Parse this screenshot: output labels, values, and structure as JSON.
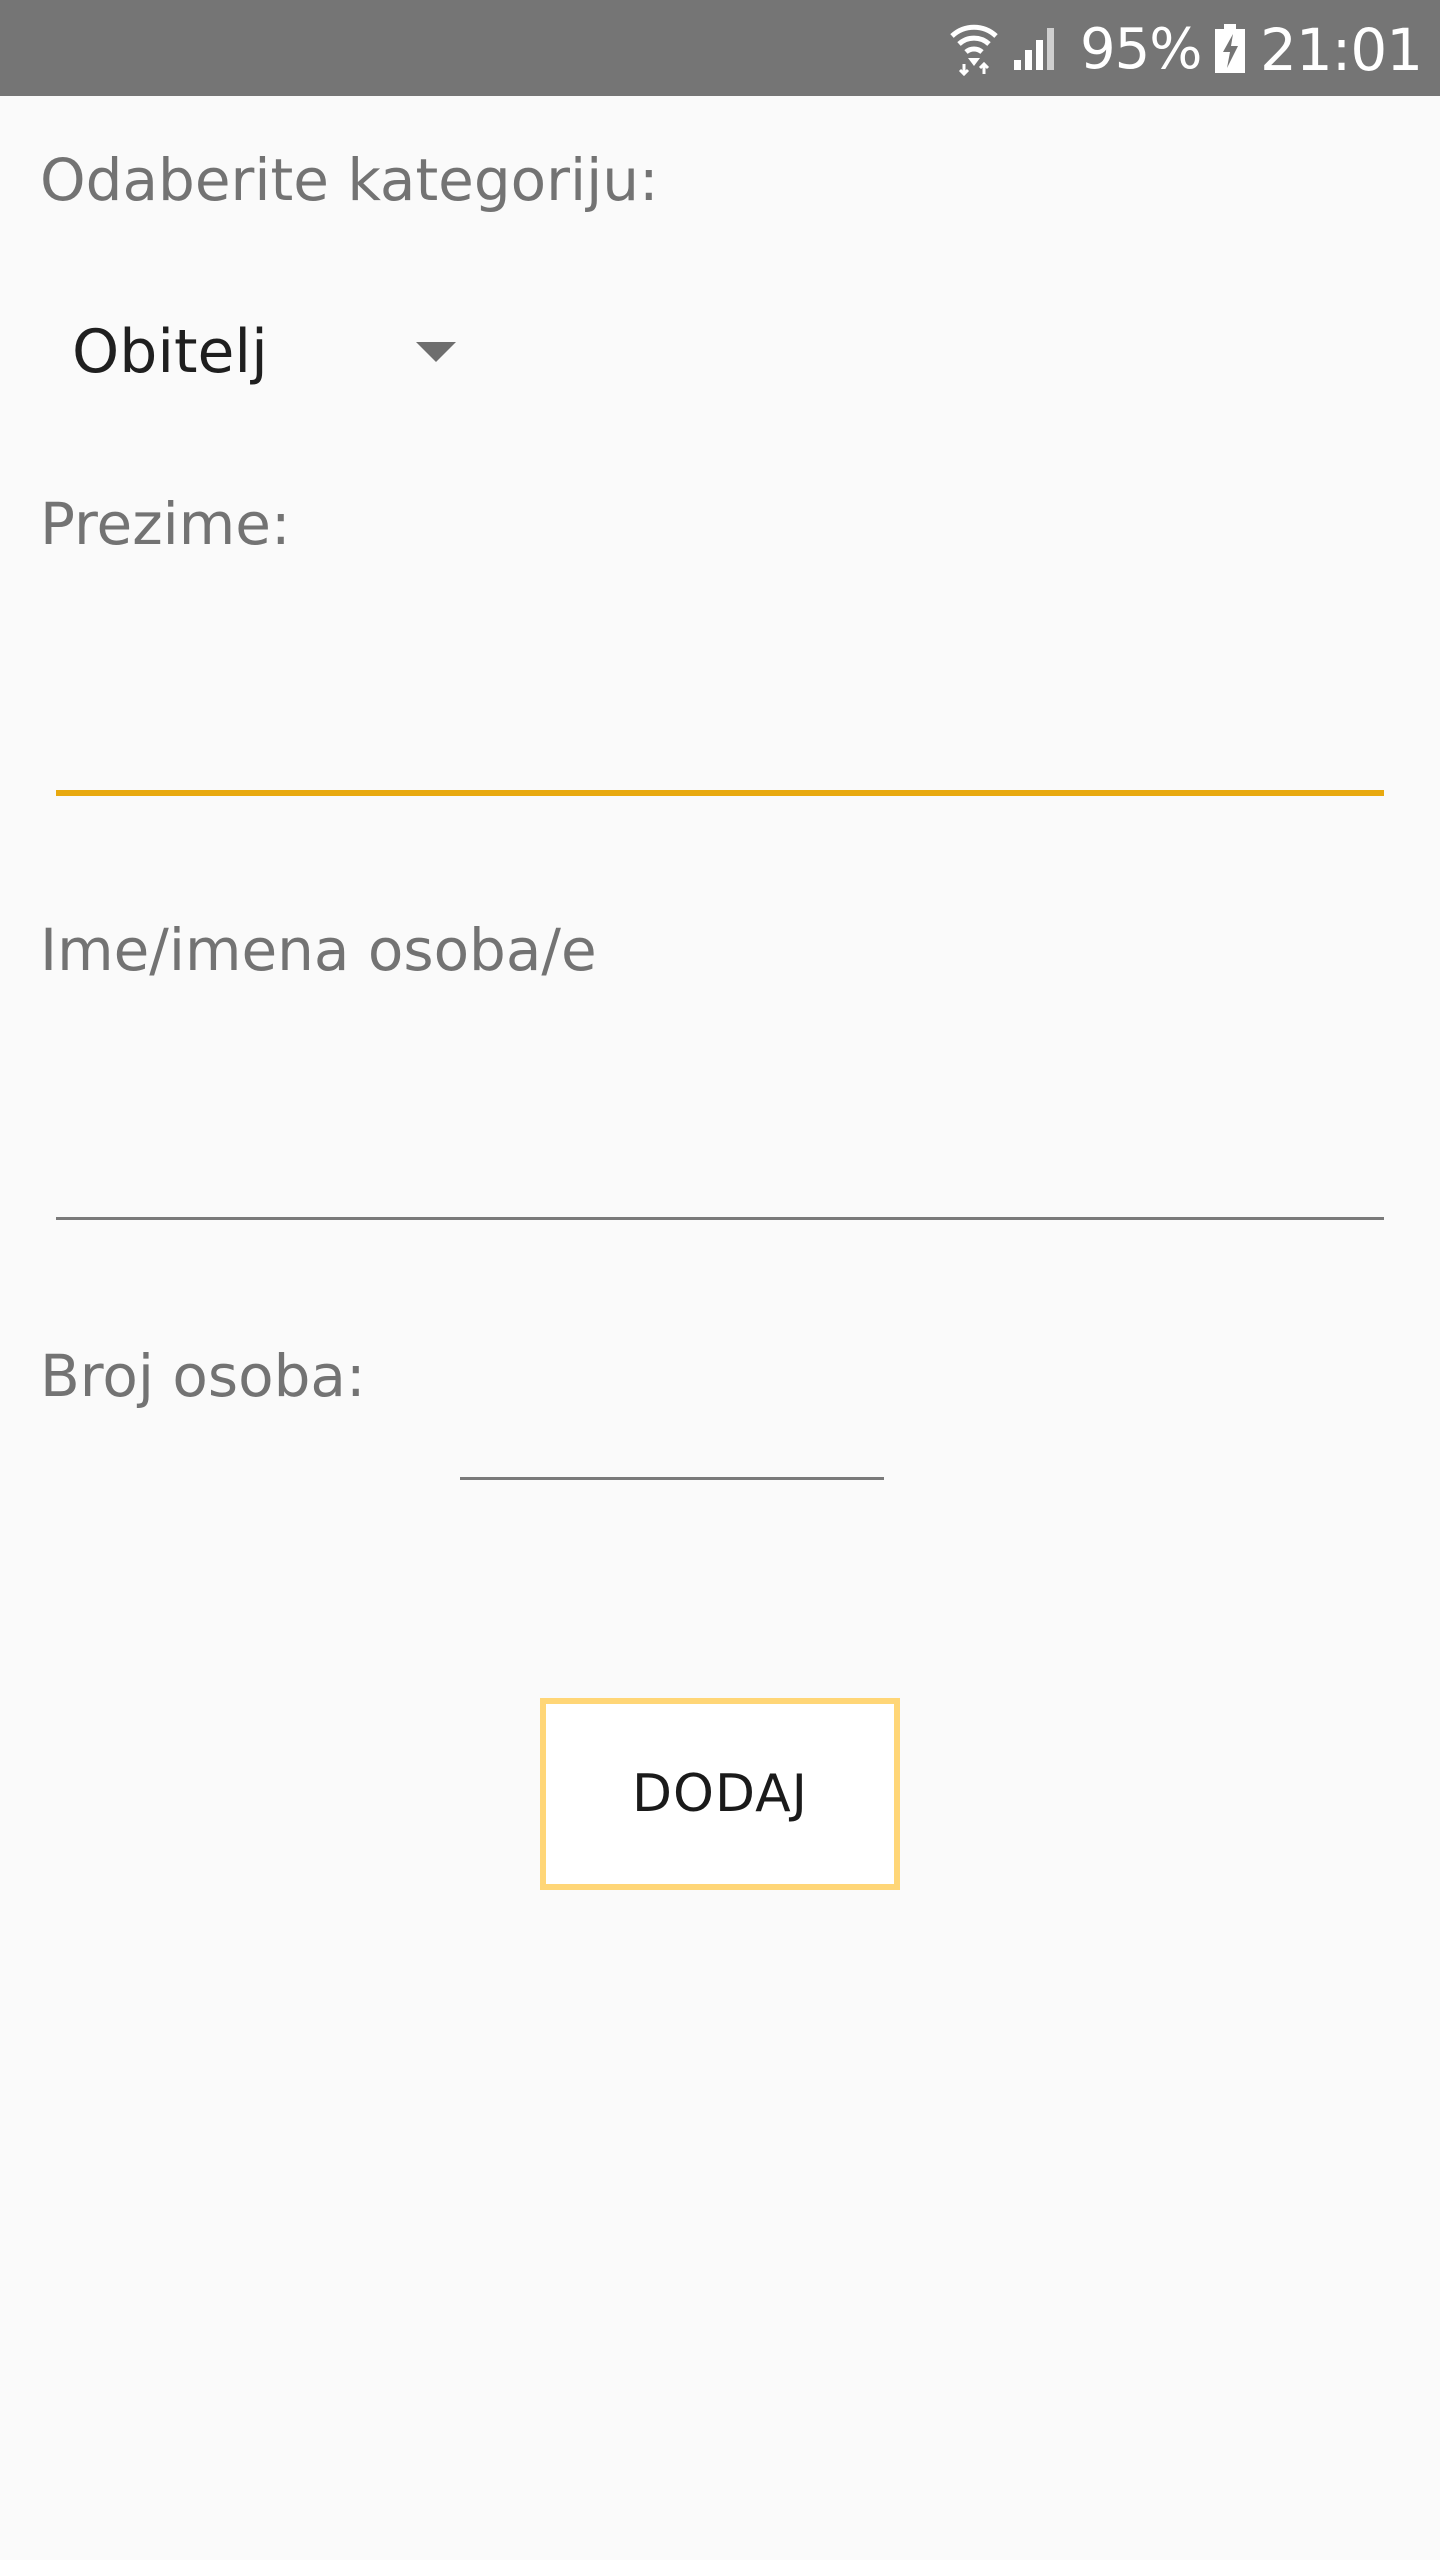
{
  "status_bar": {
    "battery_percent": "95%",
    "time": "21:01",
    "icons": [
      "wifi-icon",
      "signal-icon",
      "battery-charging-icon"
    ]
  },
  "form": {
    "category_label": "Odaberite kategoriju:",
    "category_selected": "Obitelj",
    "surname_label": "Prezime:",
    "surname_value": "",
    "names_label": "Ime/imena osoba/e",
    "names_value": "",
    "count_label": "Broj osoba:",
    "count_value": "",
    "add_button_label": "DODAJ"
  },
  "colors": {
    "status_bar": "#757575",
    "background": "#fafafa",
    "accent_underline": "#e8a90f",
    "button_border": "#ffd677",
    "label_text": "#737373"
  }
}
